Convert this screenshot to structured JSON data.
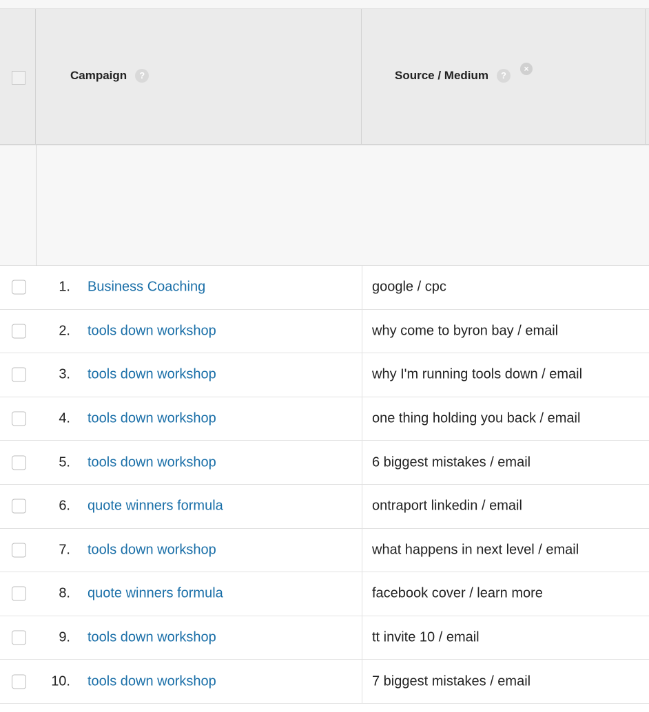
{
  "header": {
    "campaign_label": "Campaign",
    "source_medium_label": "Source / Medium",
    "help_glyph": "?",
    "remove_glyph": "×"
  },
  "rows": [
    {
      "num": "1.",
      "campaign": "Business Coaching",
      "source": "google / cpc"
    },
    {
      "num": "2.",
      "campaign": "tools down workshop",
      "source": "why come to byron bay / email"
    },
    {
      "num": "3.",
      "campaign": "tools down workshop",
      "source": "why I'm running tools down / email"
    },
    {
      "num": "4.",
      "campaign": "tools down workshop",
      "source": "one thing holding you back / email"
    },
    {
      "num": "5.",
      "campaign": "tools down workshop",
      "source": "6 biggest mistakes / email"
    },
    {
      "num": "6.",
      "campaign": "quote winners formula",
      "source": "ontraport linkedin / email"
    },
    {
      "num": "7.",
      "campaign": "tools down workshop",
      "source": "what happens in next level / email"
    },
    {
      "num": "8.",
      "campaign": "quote winners formula",
      "source": "facebook cover / learn more"
    },
    {
      "num": "9.",
      "campaign": "tools down workshop",
      "source": "tt invite 10 / email"
    },
    {
      "num": "10.",
      "campaign": "tools down workshop",
      "source": "7 biggest mistakes / email"
    }
  ],
  "colors": {
    "link": "#1a6fa8",
    "header_bg": "#ebebeb",
    "summary_bg": "#f7f7f7"
  },
  "icons": {
    "help": "help-icon",
    "remove": "remove-icon",
    "checkbox": "checkbox"
  }
}
